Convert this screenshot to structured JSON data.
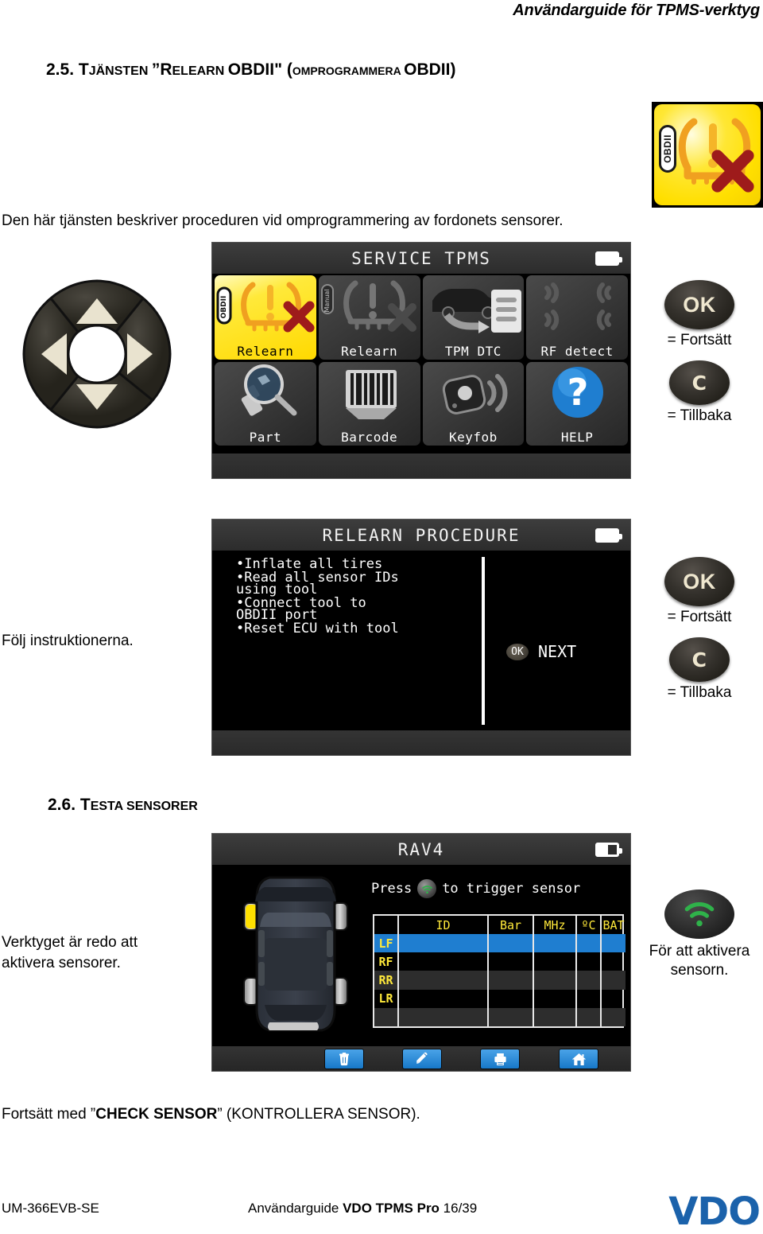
{
  "page_header": "Användarguide för TPMS-verktyg",
  "sections": {
    "s25": {
      "number": "2.5.",
      "word_t": "T",
      "word_rest": "JÄNSTEN ",
      "quote_open": "”",
      "cap_r": "R",
      "relearn_rest": "ELEARN ",
      "obdii": "OBDII\"",
      "paren_open": " (",
      "omprog": "OMPROGRAMMERA ",
      "obdii2": "OBDII)",
      "intro": "Den här tjänsten beskriver proceduren vid omprogrammering av fordonets sensorer."
    },
    "s26": {
      "number": "2.6.",
      "cap_t": "T",
      "rest": "ESTA SENSORER"
    }
  },
  "obd_logo": {
    "badge_text": "OBDII",
    "colors": {
      "yellow": "#ffd900",
      "red_x": "#9e1b1b",
      "horseshoe": "#f5a623"
    }
  },
  "screen_menu": {
    "title": "SERVICE TPMS",
    "battery_icon": "battery-full-icon",
    "items": [
      {
        "label": "Relearn",
        "icon": "obdii-relearn-icon",
        "selected": true
      },
      {
        "label": "Relearn",
        "icon": "manual-relearn-icon",
        "selected": false
      },
      {
        "label": "TPM DTC",
        "icon": "car-dtc-icon",
        "selected": false
      },
      {
        "label": "RF detect",
        "icon": "rf-detect-icon",
        "selected": false
      },
      {
        "label": "Part",
        "icon": "part-lookup-icon",
        "selected": false
      },
      {
        "label": "Barcode",
        "icon": "barcode-icon",
        "selected": false
      },
      {
        "label": "Keyfob",
        "icon": "keyfob-icon",
        "selected": false
      },
      {
        "label": "HELP",
        "icon": "help-question-icon",
        "selected": false
      }
    ]
  },
  "screen_procedure": {
    "title": "RELEARN PROCEDURE",
    "battery_icon": "battery-full-icon",
    "steps": [
      "•Inflate all tires",
      "•Read all sensor IDs\nusing tool",
      "•Connect tool to\nOBDII port",
      "•Reset ECU with tool"
    ],
    "next_key": "OK",
    "next_label": "NEXT",
    "caption": "Följ instruktionerna."
  },
  "screen_rav4": {
    "title": "RAV4",
    "battery_icon": "battery-half-icon",
    "press_prefix": "Press",
    "press_suffix": "to trigger sensor",
    "trigger_icon": "wifi-signal-icon",
    "columns": [
      "",
      "ID",
      "Bar",
      "MHz",
      "ºC",
      "BAT"
    ],
    "rows": [
      {
        "label": "LF",
        "values": [
          "",
          "",
          "",
          "",
          ""
        ],
        "selected": true
      },
      {
        "label": "RF",
        "values": [
          "",
          "",
          "",
          "",
          ""
        ],
        "selected": false
      },
      {
        "label": "RR",
        "values": [
          "",
          "",
          "",
          "",
          ""
        ],
        "selected": false
      },
      {
        "label": "LR",
        "values": [
          "",
          "",
          "",
          "",
          ""
        ],
        "selected": false
      },
      {
        "label": "",
        "values": [
          "",
          "",
          "",
          "",
          ""
        ],
        "selected": false
      }
    ],
    "toolbar": [
      {
        "icon": "trash-icon",
        "name": "delete-button"
      },
      {
        "icon": "pencil-icon",
        "name": "edit-button"
      },
      {
        "icon": "printer-icon",
        "name": "print-button"
      },
      {
        "icon": "home-icon",
        "name": "home-button"
      }
    ],
    "caption": "Verktyget är redo att aktivera sensorer."
  },
  "keys": {
    "ok_glyph": "OK",
    "ok_caption": "= Fortsätt",
    "c_glyph": "C",
    "c_caption": "= Tillbaka",
    "trigger_caption": "För att aktivera sensorn."
  },
  "dpad": {
    "up": "dpad-up-arrow",
    "down": "dpad-down-arrow",
    "left": "dpad-left-arrow",
    "right": "dpad-right-arrow"
  },
  "continue_note": {
    "prefix": "Fortsätt med ”",
    "bold": "CHECK SENSOR",
    "suffix": "” (KONTROLLERA SENSOR)."
  },
  "footer": {
    "left": "UM-366EVB-SE",
    "center_prefix": "Användarguide ",
    "center_bold": "VDO TPMS Pro",
    "center_suffix": " 16/39",
    "logo": "VDO",
    "logo_color": "#1b62ab"
  }
}
